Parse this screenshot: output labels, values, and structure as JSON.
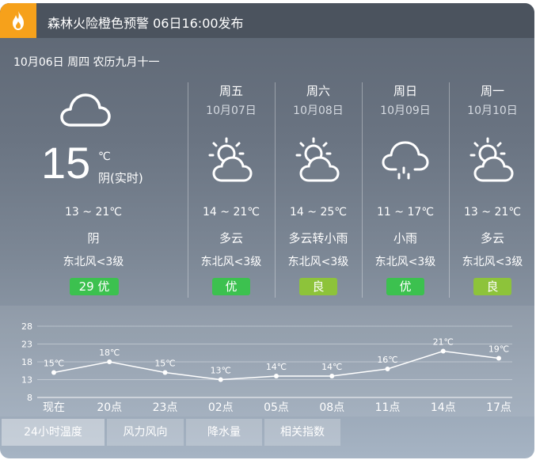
{
  "alert": {
    "text": "森林火险橙色预警 06日16:00发布",
    "icon": "fire-icon",
    "color": "#f6a11b"
  },
  "date_line": "10月06日 周四 农历九月十一",
  "today": {
    "temp": "15",
    "unit": "℃",
    "note": "阴(实时)",
    "range": "13 ~ 21℃",
    "condition": "阴",
    "wind": "东北风<3级",
    "aqi": "29  优",
    "icon": "cloud-icon"
  },
  "forecast": [
    {
      "day": "周五",
      "date": "10月07日",
      "range": "14 ~ 21℃",
      "condition": "多云",
      "wind": "东北风<3级",
      "aqi": "优",
      "aqi_level": "good",
      "icon": "partly-cloudy-icon"
    },
    {
      "day": "周六",
      "date": "10月08日",
      "range": "14 ~ 25℃",
      "condition": "多云转小雨",
      "wind": "东北风<3级",
      "aqi": "良",
      "aqi_level": "moderate",
      "icon": "partly-cloudy-icon"
    },
    {
      "day": "周日",
      "date": "10月09日",
      "range": "11 ~ 17℃",
      "condition": "小雨",
      "wind": "东北风<3级",
      "aqi": "优",
      "aqi_level": "good",
      "icon": "light-rain-icon"
    },
    {
      "day": "周一",
      "date": "10月10日",
      "range": "13 ~ 21℃",
      "condition": "多云",
      "wind": "东北风<3级",
      "aqi": "良",
      "aqi_level": "moderate",
      "icon": "partly-cloudy-icon"
    }
  ],
  "colors": {
    "aqi_good": "#3cc14f",
    "aqi_moderate": "#8dc33a"
  },
  "chart_data": {
    "type": "line",
    "x": [
      "现在",
      "20点",
      "23点",
      "02点",
      "05点",
      "08点",
      "11点",
      "14点",
      "17点"
    ],
    "series": [
      {
        "values": [
          15,
          18,
          15,
          13,
          14,
          14,
          16,
          21,
          19
        ]
      }
    ],
    "point_labels": [
      "15℃",
      "18℃",
      "15℃",
      "13℃",
      "14℃",
      "14℃",
      "16℃",
      "21℃",
      "19℃"
    ],
    "yticks": [
      "28",
      "23",
      "18",
      "13",
      "8"
    ],
    "ylim": [
      8,
      28
    ],
    "grid": true
  },
  "tabs": [
    "24小时温度",
    "风力风向",
    "降水量",
    "相关指数"
  ]
}
